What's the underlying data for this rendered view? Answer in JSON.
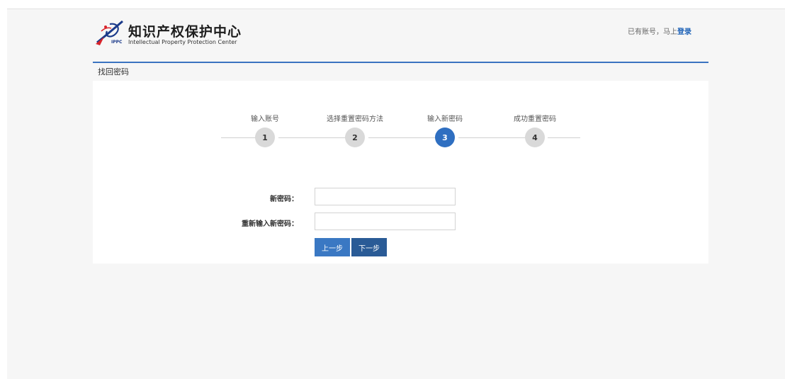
{
  "header": {
    "logo_cn": "知识产权保护中心",
    "logo_abbr": "IPPC",
    "logo_en": "Intellectual Property Protection Center",
    "login_prompt": "已有账号，马上",
    "login_link": "登录"
  },
  "section_title": "找回密码",
  "steps": [
    {
      "number": "1",
      "label": "输入账号",
      "active": false
    },
    {
      "number": "2",
      "label": "选择重置密码方法",
      "active": false
    },
    {
      "number": "3",
      "label": "输入新密码",
      "active": true
    },
    {
      "number": "4",
      "label": "成功重置密码",
      "active": false
    }
  ],
  "form": {
    "new_password_label": "新密码：",
    "new_password_value": "",
    "confirm_password_label": "重新输入新密码：",
    "confirm_password_value": "",
    "prev_button": "上一步",
    "next_button": "下一步"
  },
  "colors": {
    "accent": "#3b74c1",
    "active_step": "#2f6fc1",
    "inactive_step": "#d9d9d9",
    "login_link": "#1e62b7",
    "prev_button": "#3a78c3",
    "next_button": "#2a5b96"
  }
}
